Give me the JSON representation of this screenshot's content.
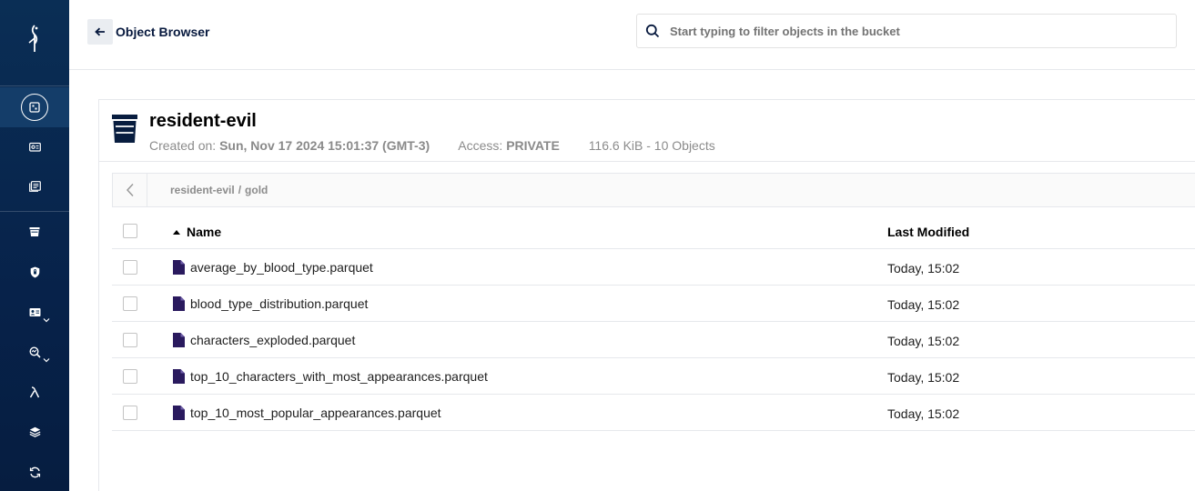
{
  "colors": {
    "sidebar": "#0a2e55",
    "sidebar_active": "#143d69",
    "accent_dark": "#07193e",
    "file_icon": "#2a1a5e"
  },
  "sidebar": {
    "logo": "minio-bird-logo",
    "items": [
      {
        "icon": "object-browser-icon",
        "active": true
      },
      {
        "icon": "access-keys-icon"
      },
      {
        "icon": "documentation-icon"
      },
      {
        "icon": "buckets-icon"
      },
      {
        "icon": "policies-icon"
      },
      {
        "icon": "identity-icon",
        "expandable": true
      },
      {
        "icon": "monitoring-icon",
        "expandable": true
      },
      {
        "icon": "events-lambda-icon"
      },
      {
        "icon": "tiering-icon"
      },
      {
        "icon": "site-replication-icon"
      }
    ]
  },
  "topbar": {
    "title": "Object Browser",
    "search_placeholder": "Start typing to filter objects in the bucket"
  },
  "bucket": {
    "name": "resident-evil",
    "created_label": "Created on:",
    "created_value": "Sun, Nov 17 2024 15:01:37 (GMT-3)",
    "access_label": "Access:",
    "access_value": "PRIVATE",
    "summary": "116.6 KiB - 10 Objects"
  },
  "breadcrumb": {
    "root": "resident-evil",
    "separator": "/",
    "current": "gold"
  },
  "table": {
    "col_name": "Name",
    "col_modified": "Last Modified",
    "rows": [
      {
        "name": "average_by_blood_type.parquet",
        "modified": "Today, 15:02"
      },
      {
        "name": "blood_type_distribution.parquet",
        "modified": "Today, 15:02"
      },
      {
        "name": "characters_exploded.parquet",
        "modified": "Today, 15:02"
      },
      {
        "name": "top_10_characters_with_most_appearances.parquet",
        "modified": "Today, 15:02"
      },
      {
        "name": "top_10_most_popular_appearances.parquet",
        "modified": "Today, 15:02"
      }
    ]
  }
}
